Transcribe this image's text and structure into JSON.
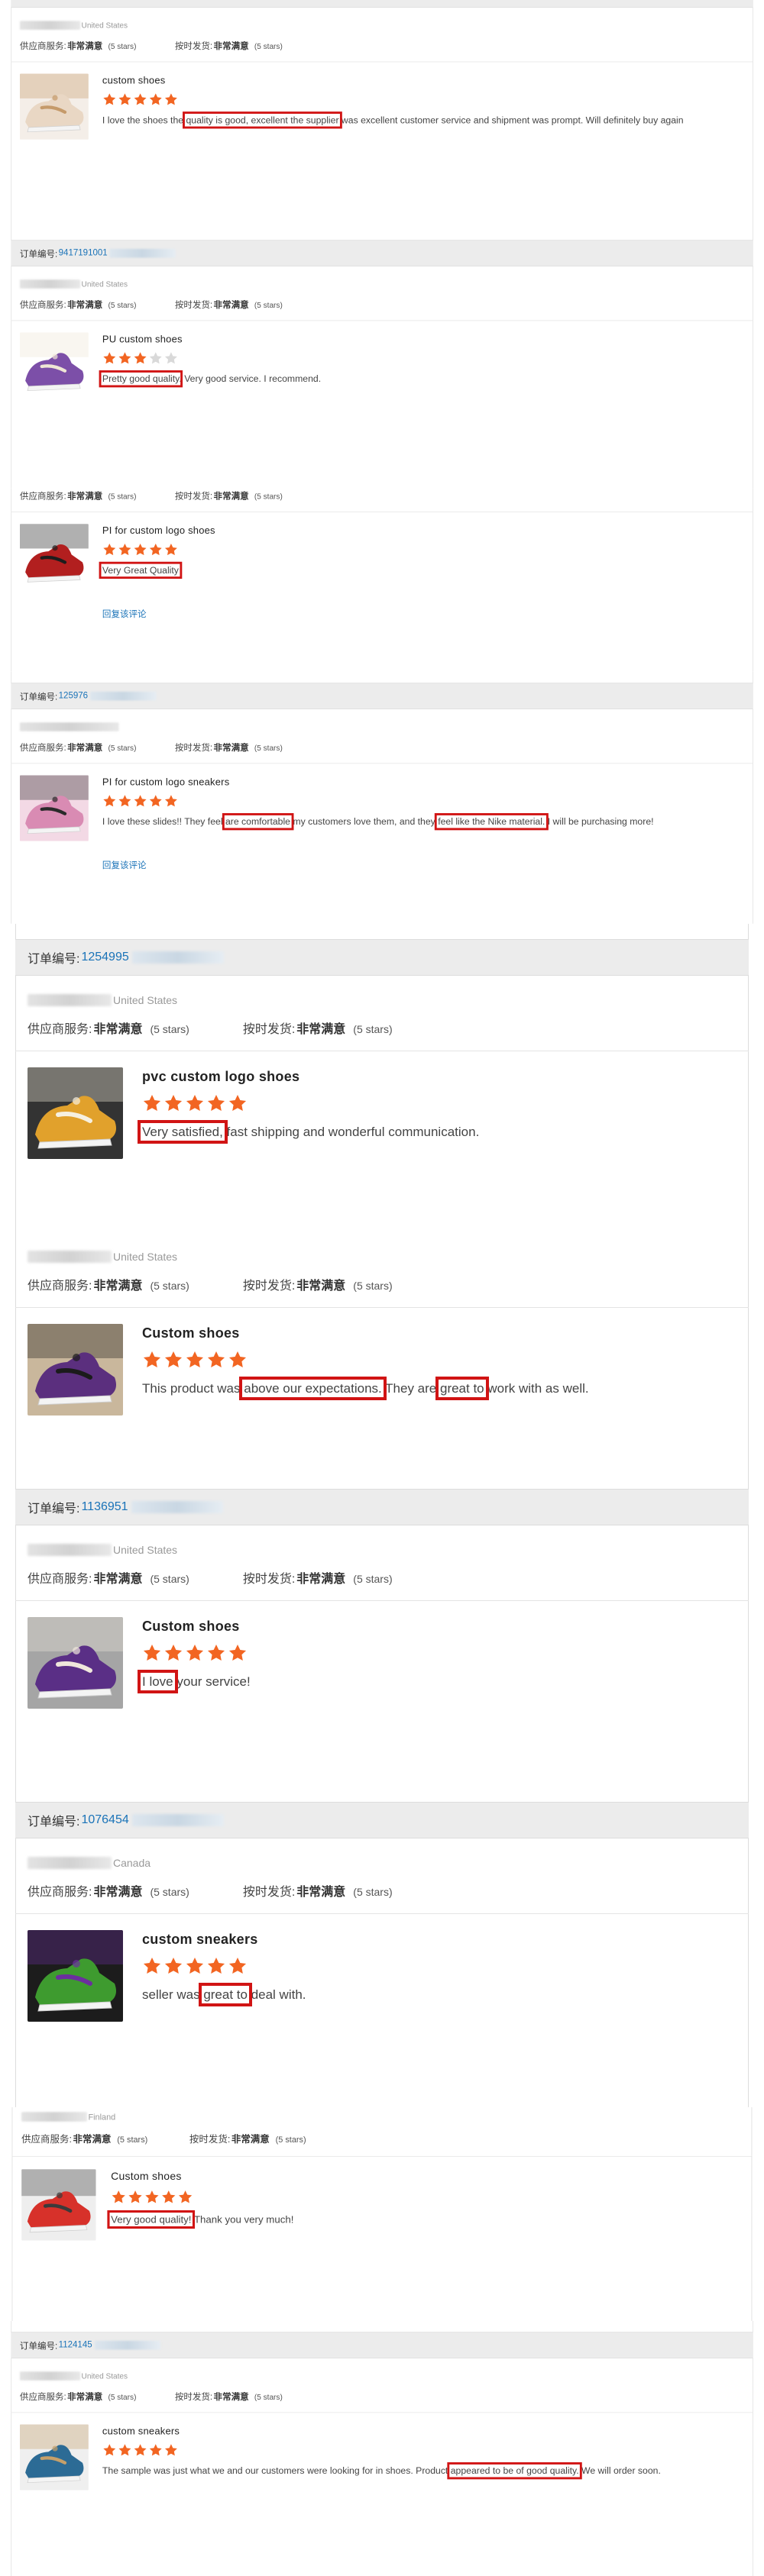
{
  "labels": {
    "order_no": "订单编号:",
    "supplier_service": "供应商服务:",
    "on_time": "按时发货:",
    "very_satisfied": "非常满意",
    "five_stars": "(5 stars)",
    "reply_link": "回复该评论"
  },
  "colors": {
    "star": "#f26522",
    "star_empty": "#d9d9d9",
    "highlight_box": "#d11414",
    "link": "#1a73b8"
  },
  "reviews": [
    {
      "country": "United States",
      "product": "custom shoes",
      "rating": 5,
      "text": "I love the shoes the quality is good, excellent the supplier was excellent customer service and shipment was prompt. Will definitely buy again",
      "highlights": [
        "quality is good, excellent the supplier"
      ]
    },
    {
      "order_no": "9417191001",
      "country": "United States",
      "product": "PU custom shoes",
      "rating": 3,
      "text": "Pretty good quality. Very good service. I recommend.",
      "highlights": [
        "Pretty good quality"
      ]
    },
    {
      "product": "PI for custom logo shoes",
      "rating": 5,
      "text": "Very Great Quality",
      "highlights": [
        "Very Great Quality"
      ],
      "reply": true
    },
    {
      "order_no": "125976",
      "product": "PI for custom logo sneakers",
      "rating": 5,
      "text": "I love these slides!! They feel are comfortable my customers love them, and they feel like the Nike material. I will be purchasing more!",
      "highlights": [
        "are comfortable",
        "feel like the Nike material."
      ],
      "reply": true
    },
    {
      "order_no": "1254995",
      "country": "United States",
      "product": "pvc custom logo shoes",
      "rating": 5,
      "text": "Very satisfied, fast shipping and wonderful communication.",
      "highlights": [
        "Very satisfied,"
      ]
    },
    {
      "country": "United States",
      "product": "Custom shoes",
      "rating": 5,
      "text": "This product was above our expectations. They are great to work with as well.",
      "highlights": [
        "above our expectations.",
        "great to"
      ]
    },
    {
      "order_no": "1136951",
      "country": "United States",
      "product": "Custom shoes",
      "rating": 5,
      "text": "I love your service!",
      "highlights": [
        "I love"
      ]
    },
    {
      "order_no": "1076454",
      "country": "Canada",
      "product": "custom sneakers",
      "rating": 5,
      "text": "seller was great to deal with.",
      "highlights": [
        "great to"
      ]
    },
    {
      "country": "Finland",
      "product": "Custom shoes",
      "rating": 5,
      "text": "Very good quality! Thank you very much!",
      "highlights": [
        "Very good quality!"
      ]
    },
    {
      "order_no": "1124145",
      "country": "United States",
      "product": "custom sneakers",
      "rating": 5,
      "text": "The sample was just what we and our customers were looking for in shoes. Product appeared to be of good quality. We will order soon.",
      "highlights": [
        "appeared to be of good quality."
      ]
    }
  ]
}
